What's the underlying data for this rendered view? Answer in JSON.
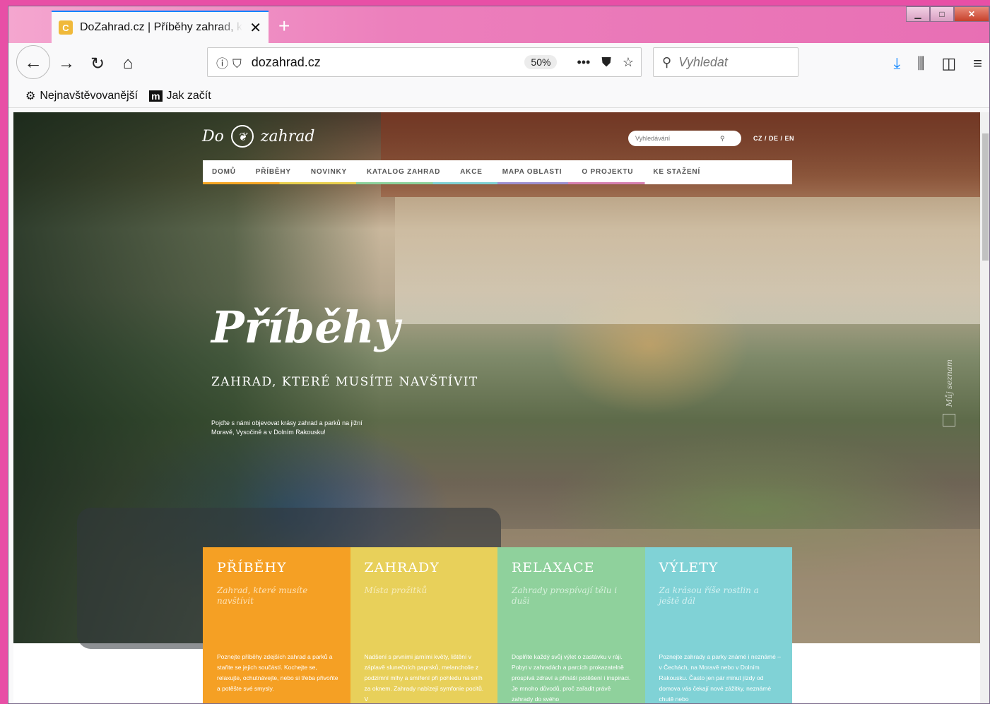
{
  "browser": {
    "tab_title": "DoZahrad.cz | Příběhy zahrad, k",
    "tab_favicon_letter": "C",
    "new_tab": "+",
    "window_controls": {
      "minimize": "▁",
      "maximize": "□",
      "close": "✕"
    },
    "url": "dozahrad.cz",
    "zoom": "50%",
    "search_placeholder": "Vyhledat",
    "bookmarks": [
      {
        "label": "Nejnavštěvovanější",
        "icon": "gear-icon"
      },
      {
        "label": "Jak začít",
        "icon": "m-logo-icon",
        "icon_text": "m"
      }
    ]
  },
  "site": {
    "logo_do": "Do",
    "logo_zahrad": "zahrad",
    "search_placeholder": "Vyhledávání",
    "lang": "CZ / DE / EN",
    "nav": [
      "DOMŮ",
      "PŘÍBĚHY",
      "NOVINKY",
      "KATALOG ZAHRAD",
      "AKCE",
      "MAPA OBLASTI",
      "O PROJEKTU",
      "KE STAŽENÍ"
    ],
    "hero": {
      "title": "Příběhy",
      "subtitle": "ZAHRAD, KTERÉ MUSÍTE NAVŠTÍVIT",
      "description": "Pojďte s námi objevovat krásy zahrad a parků na jižní Moravě, Vysočině a v Dolním Rakousku!"
    },
    "side_list": "Můj seznam",
    "cards": [
      {
        "title": "PŘÍBĚHY",
        "tagline": "Zahrad, které musíte navštívit",
        "text": "Poznejte příběhy zdejších zahrad a parků a staňte se jejich součástí. Kochejte se, relaxujte, ochutnávejte, nebo si třeba přivoňte a potěšte své smysly."
      },
      {
        "title": "ZAHRADY",
        "tagline": "Místa prožitků",
        "text": "Nadšení s prvními jarními květy, lištění v záplavě slunečních paprsků, melancholie z podzimní mlhy a smíření při pohledu na sníh za oknem. Zahrady nabízejí symfonie pocitů. V"
      },
      {
        "title": "RELAXACE",
        "tagline": "Zahrady prospívají tělu i duši",
        "text": "Doplňte každý svůj výlet o zastávku v ráji. Pobyt v zahradách a parcích prokazatelně prospívá zdraví a přináší potěšení i inspiraci. Je mnoho důvodů, proč zařadit právě zahrady do svého"
      },
      {
        "title": "VÝLETY",
        "tagline": "Za krásou říše rostlin a ještě dál",
        "text": "Poznejte zahrady a parky známé i neznámé – v Čechách, na Moravě nebo v Dolním Rakousku. Často jen pár minut jízdy od domova vás čekají nové zážitky, neznámé chutě nebo"
      }
    ]
  }
}
